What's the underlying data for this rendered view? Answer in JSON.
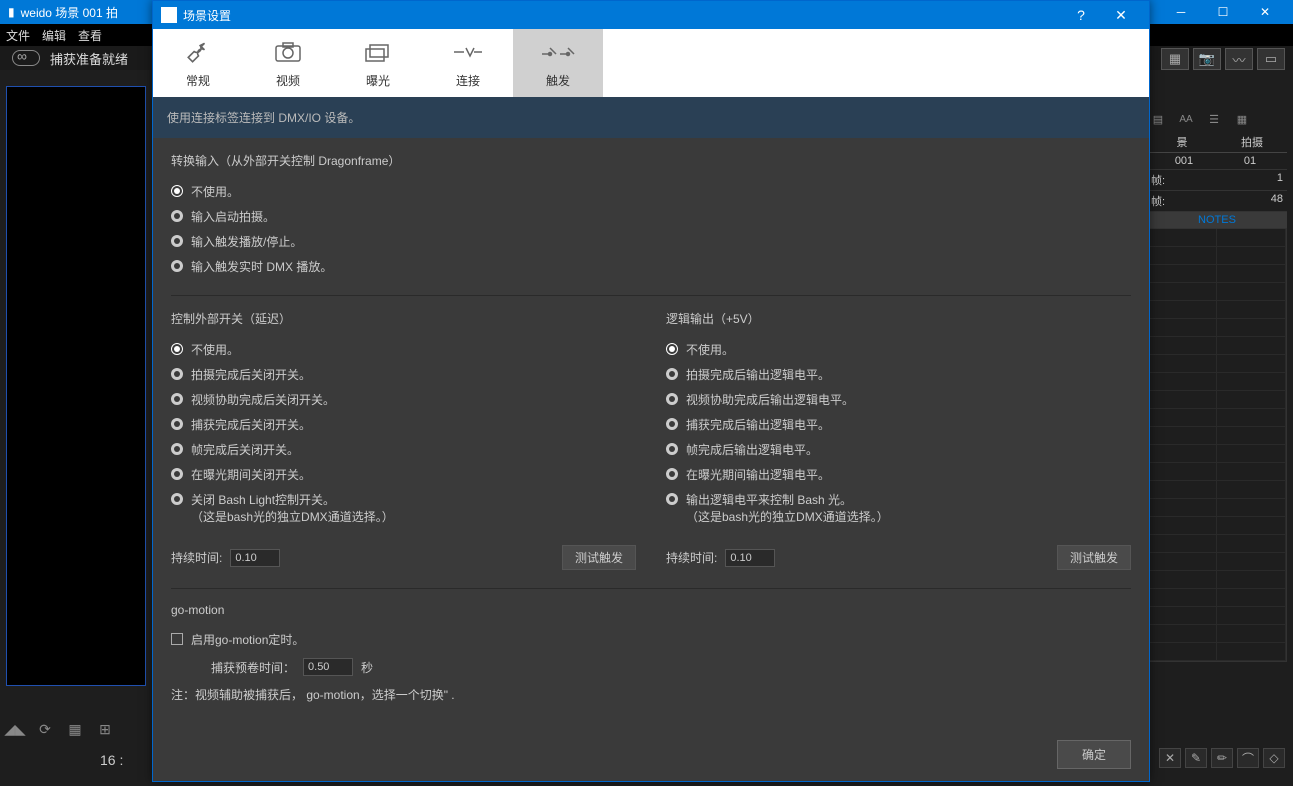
{
  "bgApp": {
    "title": "weido  场景 001  拍",
    "menus": [
      "文件",
      "编辑",
      "查看"
    ],
    "status": "捕获准备就绪",
    "frameNum": "16 :"
  },
  "rightPanel": {
    "tabs": [
      "景",
      "拍摄"
    ],
    "tabVals": [
      "001",
      "01"
    ],
    "rows": [
      {
        "l": "帧:",
        "r": "1"
      },
      {
        "l": "帧:",
        "r": "48"
      }
    ],
    "notesLabel": "NOTES"
  },
  "dialog": {
    "title": "场景设置",
    "tabs": [
      {
        "label": "常规",
        "icon": "wrench"
      },
      {
        "label": "视频",
        "icon": "camera"
      },
      {
        "label": "曝光",
        "icon": "layers"
      },
      {
        "label": "连接",
        "icon": "link"
      },
      {
        "label": "触发",
        "icon": "trigger"
      }
    ],
    "activeTab": 4,
    "infoText": "使用连接标签连接到 DMX/IO 设备。",
    "section1": {
      "title": "转换输入（从外部开关控制 Dragonframe）",
      "options": [
        "不使用。",
        "输入启动拍摄。",
        "输入触发播放/停止。",
        "输入触发实时 DMX 播放。"
      ],
      "selected": 0
    },
    "section2": {
      "title": "控制外部开关（延迟）",
      "options": [
        "不使用。",
        "拍摄完成后关闭开关。",
        "视频协助完成后关闭开关。",
        "捕获完成后关闭开关。",
        "帧完成后关闭开关。",
        "在曝光期间关闭开关。",
        "关闭 Bash Light控制开关。\n（这是bash光的独立DMX通道选择。）"
      ],
      "selected": 0,
      "durationLabel": "持续时间:",
      "durationValue": "0.10",
      "testBtn": "测试触发"
    },
    "section3": {
      "title": "逻辑输出（+5V）",
      "options": [
        "不使用。",
        "拍摄完成后输出逻辑电平。",
        "视频协助完成后输出逻辑电平。",
        "捕获完成后输出逻辑电平。",
        "帧完成后输出逻辑电平。",
        "在曝光期间输出逻辑电平。",
        "输出逻辑电平来控制 Bash 光。\n（这是bash光的独立DMX通道选择。）"
      ],
      "selected": 0,
      "durationLabel": "持续时间:",
      "durationValue": "0.10",
      "testBtn": "测试触发"
    },
    "section4": {
      "title": "go-motion",
      "checkLabel": "启用go-motion定时。",
      "rollLabel": "捕获预卷时间：",
      "rollValue": "0.50",
      "rollUnit": "秒",
      "note": "注：视频辅助被捕获后， go-motion，选择一个切换\" ."
    },
    "okBtn": "确定"
  }
}
